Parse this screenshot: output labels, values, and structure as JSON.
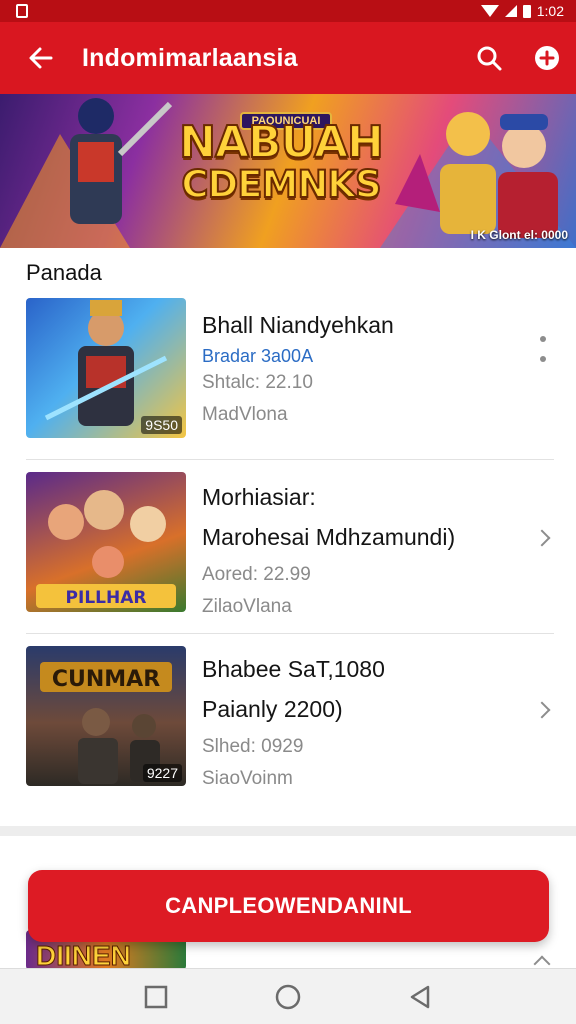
{
  "status_bar": {
    "time": "1:02"
  },
  "app_bar": {
    "title": "Indomimarlaansia"
  },
  "banner": {
    "subtitle": "PAQUNICUAI",
    "title_line1": "NABUAH",
    "title_line2": "CDEMNKS",
    "credit": "I K Glont el: 0000"
  },
  "section": {
    "title": "Panada"
  },
  "games": [
    {
      "line1": "Bhall Niandyehkan",
      "tag": "Bradar 3a00A",
      "meta1": "Shtalc: 22.10",
      "meta2": "MadVlona",
      "thumb_badge": "9S50",
      "action": "more-menu"
    },
    {
      "line1": "Morhiasiar:",
      "line2": "Marohesai Mdhzamundi)",
      "meta1": "Aored: 22.99",
      "meta2": "ZilaoVlana",
      "action": "chevron"
    },
    {
      "line1": "Bhabee SaT,1080",
      "line2": "Paianly 2200)",
      "meta1": "Slhed: 0929",
      "meta2": "SiaoVoinm",
      "thumb_badge": "9227",
      "action": "chevron"
    }
  ],
  "peek": {
    "thumb_text": "DIINEN"
  },
  "cta": {
    "label": "CANPLEOWENDANINL"
  },
  "colors": {
    "accent": "#d91720",
    "status": "#b80e14",
    "tag": "#2b6cc4"
  },
  "icons": [
    "back-arrow-icon",
    "search-icon",
    "add-circle-icon",
    "more-vertical-icon",
    "chevron-right-icon",
    "nav-square-icon",
    "nav-circle-icon",
    "nav-back-triangle-icon"
  ]
}
